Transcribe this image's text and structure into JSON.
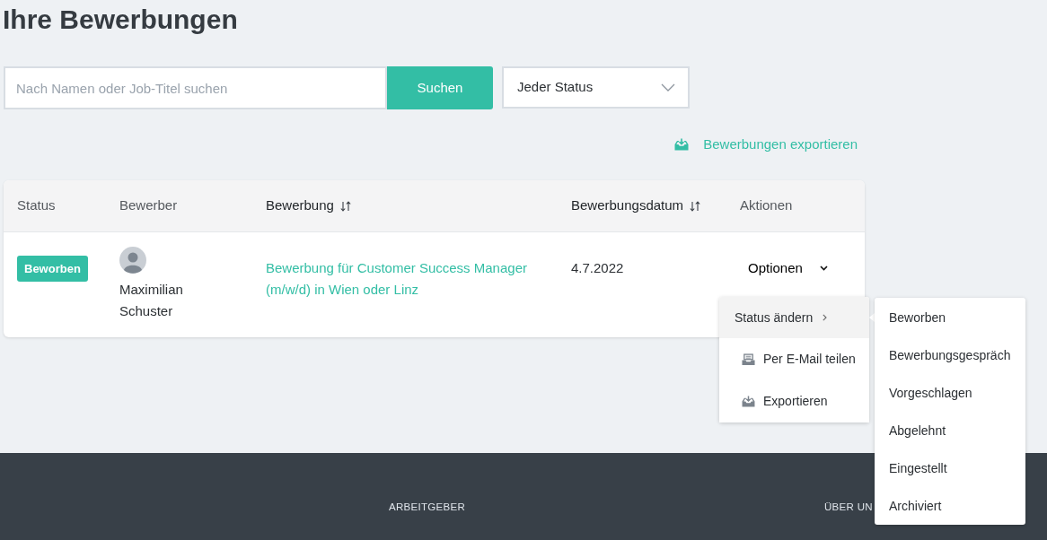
{
  "page": {
    "title": "Ihre Bewerbungen"
  },
  "filters": {
    "search": {
      "placeholder": "Nach Namen oder Job-Titel suchen"
    },
    "search_button": "Suchen",
    "status_select": {
      "value": "Jeder Status"
    }
  },
  "export_link": "Bewerbungen exportieren",
  "table": {
    "columns": [
      {
        "label": "Status",
        "sortable": false
      },
      {
        "label": "Bewerber",
        "sortable": false
      },
      {
        "label": "Bewerbung",
        "sortable": true
      },
      {
        "label": "Bewerbungsdatum",
        "sortable": true
      },
      {
        "label": "Aktionen",
        "sortable": false
      }
    ],
    "rows": [
      {
        "status": "Beworben",
        "applicant": "Maximilian Schuster",
        "application": "Bewerbung für Customer Success Manager (m/w/d) in Wien oder Linz",
        "date": "4.7.2022",
        "actions": "Optionen"
      }
    ]
  },
  "actions_menu": {
    "items": [
      {
        "label": "Status ändern",
        "kind": "submenu",
        "selected": true
      },
      {
        "label": "Per E-Mail teilen",
        "kind": "email",
        "selected": false
      },
      {
        "label": "Exportieren",
        "kind": "export",
        "selected": false
      }
    ]
  },
  "status_submenu": {
    "items": [
      "Beworben",
      "Bewerbungsgespräch",
      "Vorgeschlagen",
      "Abgelehnt",
      "Eingestellt",
      "Archiviert"
    ]
  },
  "footer": {
    "headings": [
      "ARBEITGEBER",
      "ÜBER UN"
    ]
  }
}
